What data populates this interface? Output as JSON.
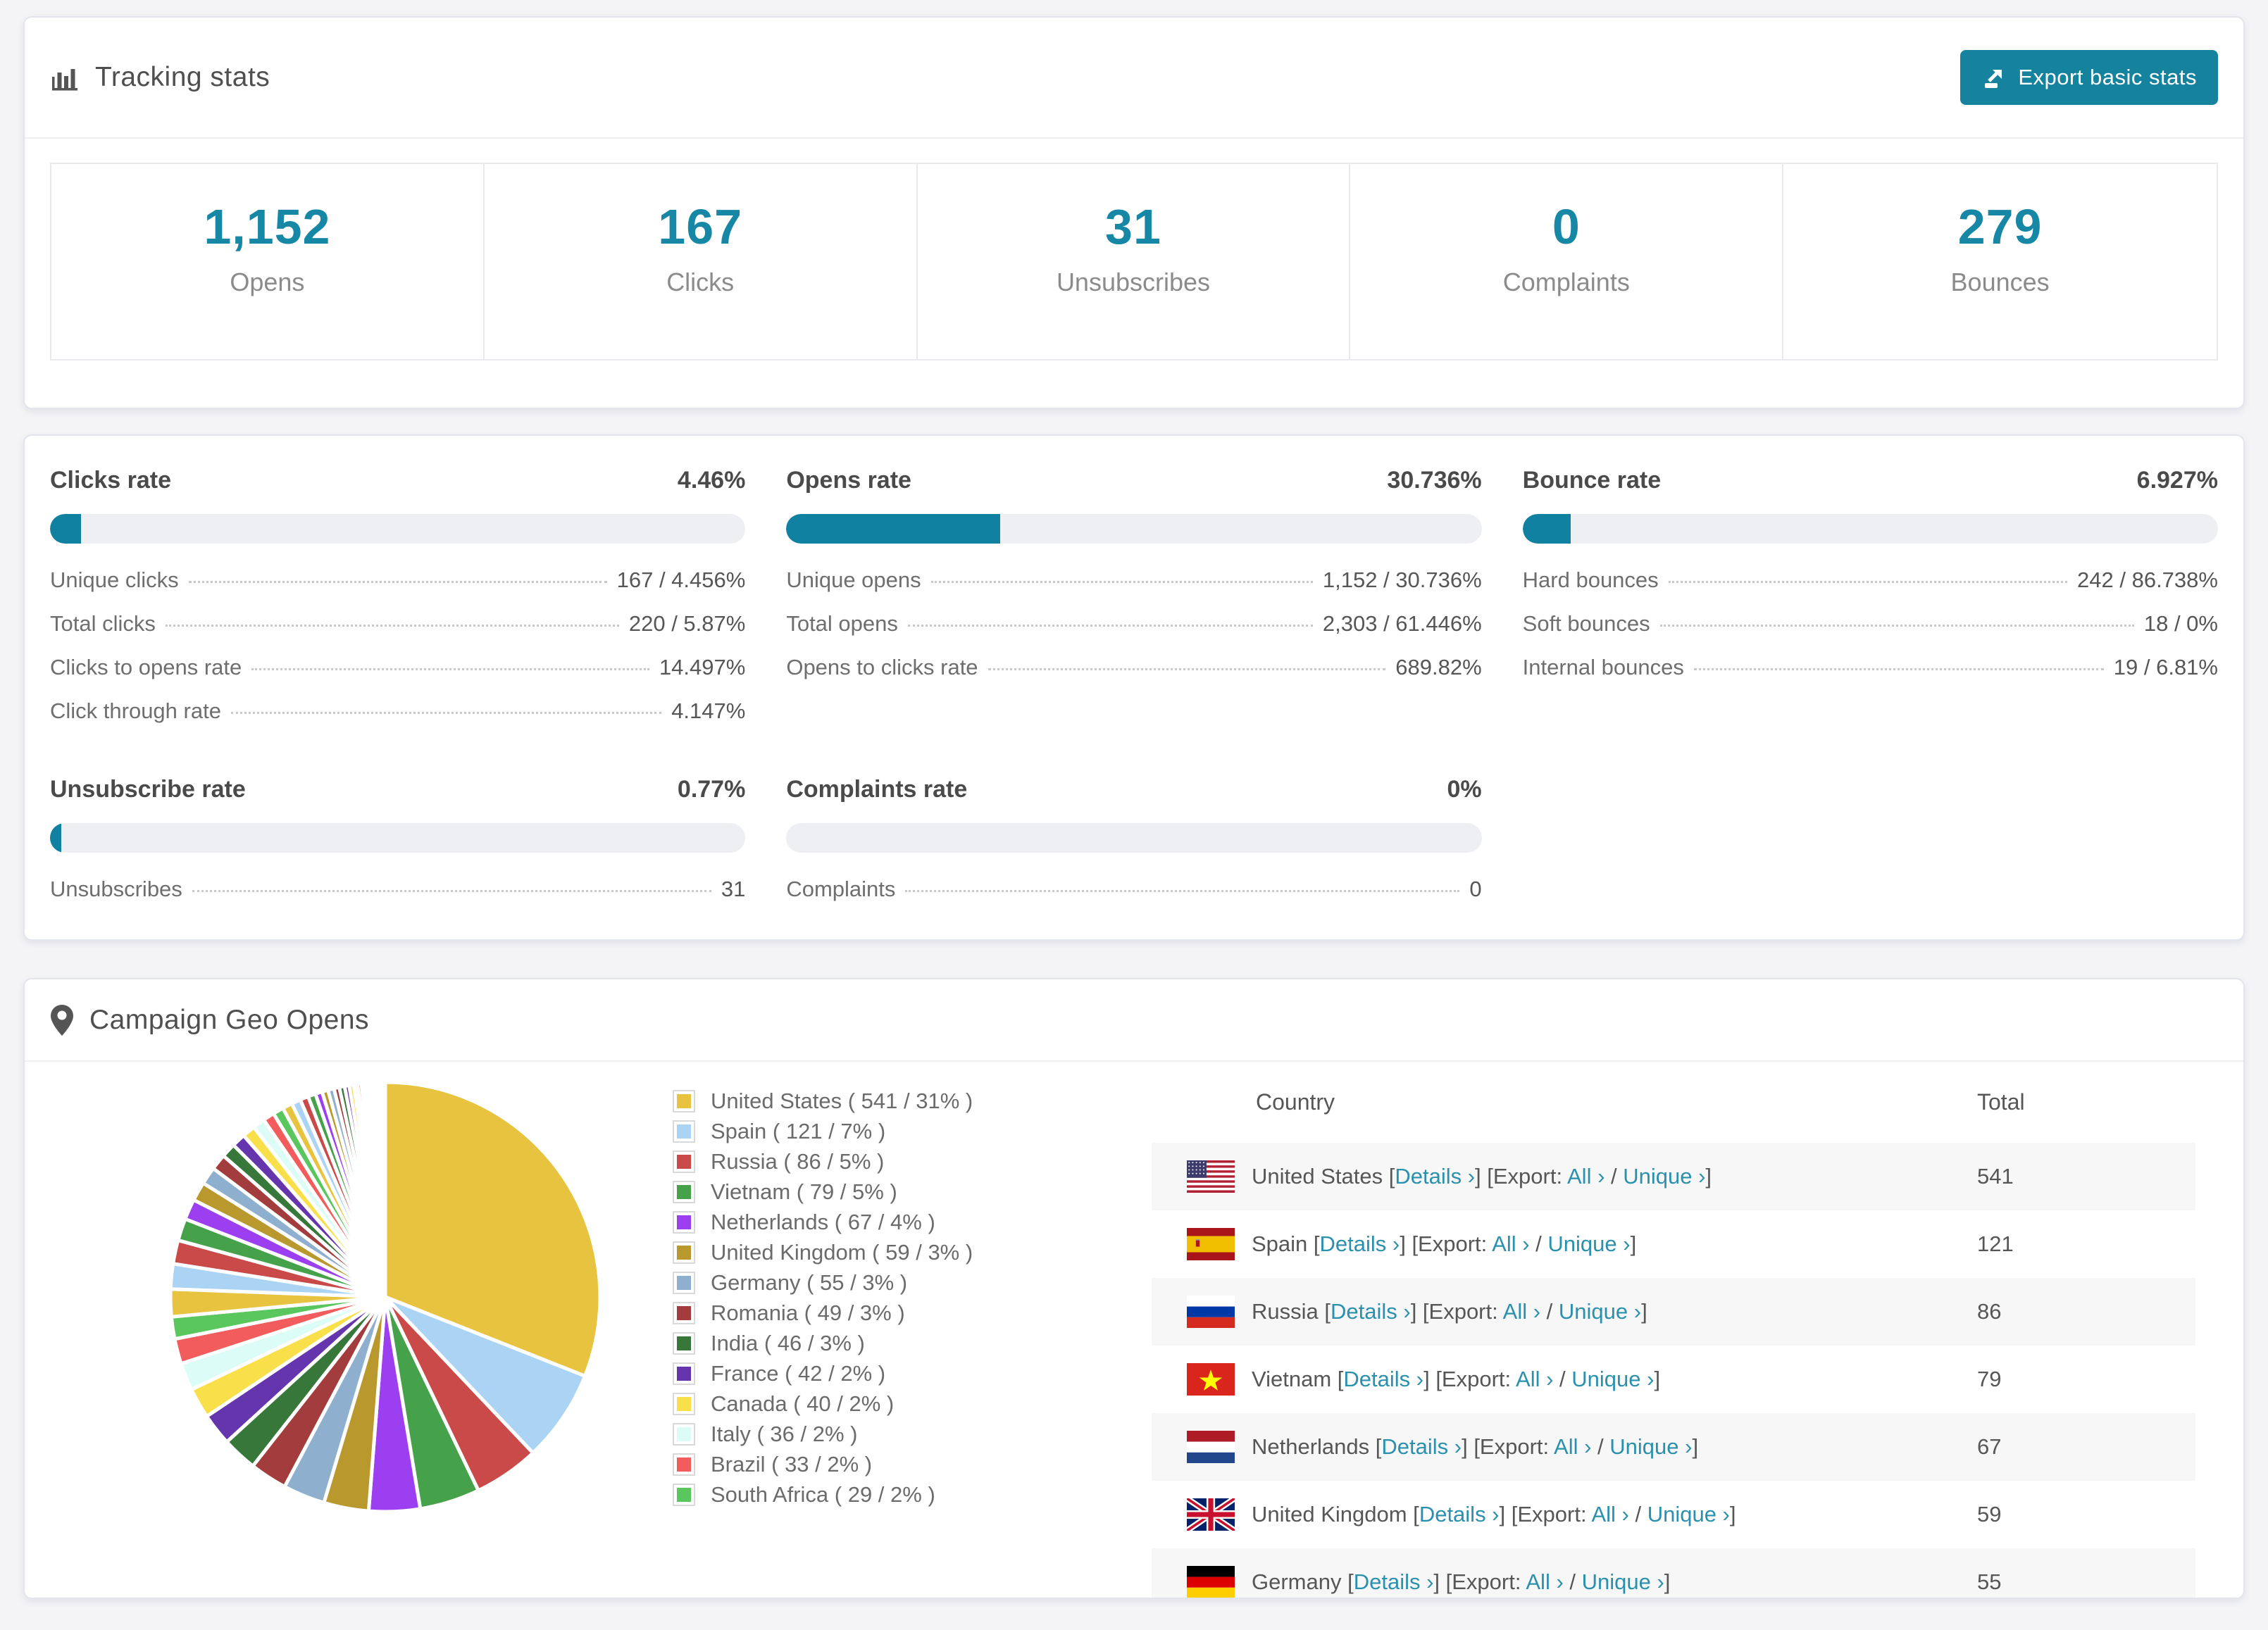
{
  "accent": {
    "teal_number": "#1787a6",
    "bar_fill": "#1081a1",
    "link": "#2b90ae",
    "button_bg": "#15839e"
  },
  "tracking": {
    "title": "Tracking stats",
    "export_button": "Export basic stats",
    "stats": [
      {
        "value": "1,152",
        "label": "Opens"
      },
      {
        "value": "167",
        "label": "Clicks"
      },
      {
        "value": "31",
        "label": "Unsubscribes"
      },
      {
        "value": "0",
        "label": "Complaints"
      },
      {
        "value": "279",
        "label": "Bounces"
      }
    ]
  },
  "rates": {
    "blocks": [
      {
        "title": "Clicks rate",
        "value": "4.46%",
        "percent": 4.46,
        "rows": [
          [
            "Unique clicks",
            "167 / 4.456%"
          ],
          [
            "Total clicks",
            "220 / 5.87%"
          ],
          [
            "Clicks to opens rate",
            "14.497%"
          ],
          [
            "Click through rate",
            "4.147%"
          ]
        ]
      },
      {
        "title": "Opens rate",
        "value": "30.736%",
        "percent": 30.736,
        "rows": [
          [
            "Unique opens",
            "1,152 / 30.736%"
          ],
          [
            "Total opens",
            "2,303 / 61.446%"
          ],
          [
            "Opens to clicks rate",
            "689.82%"
          ]
        ]
      },
      {
        "title": "Bounce rate",
        "value": "6.927%",
        "percent": 6.927,
        "rows": [
          [
            "Hard bounces",
            "242 / 86.738%"
          ],
          [
            "Soft bounces",
            "18 / 0%"
          ],
          [
            "Internal bounces",
            "19 / 6.81%"
          ]
        ]
      },
      {
        "title": "Unsubscribe rate",
        "value": "0.77%",
        "percent": 0.77,
        "rows": [
          [
            "Unsubscribes",
            "31"
          ]
        ]
      },
      {
        "title": "Complaints rate",
        "value": "0%",
        "percent": 0,
        "rows": [
          [
            "Complaints",
            "0"
          ]
        ]
      }
    ]
  },
  "geo": {
    "title": "Campaign Geo Opens",
    "table": {
      "col_country": "Country",
      "col_total": "Total",
      "bracket_open": "[",
      "bracket_close": "]",
      "details_label": "Details ›",
      "export_label": "Export:",
      "all_label": "All ›",
      "slash": "/",
      "unique_label": "Unique ›",
      "rows": [
        {
          "country": "United States",
          "flag": "us",
          "total": "541"
        },
        {
          "country": "Spain",
          "flag": "es",
          "total": "121"
        },
        {
          "country": "Russia",
          "flag": "ru",
          "total": "86"
        },
        {
          "country": "Vietnam",
          "flag": "vn",
          "total": "79"
        },
        {
          "country": "Netherlands",
          "flag": "nl",
          "total": "67"
        },
        {
          "country": "United Kingdom",
          "flag": "gb",
          "total": "59"
        },
        {
          "country": "Germany",
          "flag": "de",
          "total": "55"
        }
      ]
    }
  },
  "chart_data": {
    "type": "pie",
    "title": "Campaign Geo Opens",
    "legend_position": "right",
    "start_angle_deg": 0,
    "direction": "clockwise",
    "slices": [
      {
        "label": "United States",
        "legend": "United States ( 541 / 31% )",
        "value": 541,
        "pct": 31,
        "color": "#e8c33f"
      },
      {
        "label": "Spain",
        "legend": "Spain ( 121 / 7% )",
        "value": 121,
        "pct": 7,
        "color": "#abd4f4"
      },
      {
        "label": "Russia",
        "legend": "Russia ( 86 / 5% )",
        "value": 86,
        "pct": 5,
        "color": "#ca4a4a"
      },
      {
        "label": "Vietnam",
        "legend": "Vietnam ( 79 / 5% )",
        "value": 79,
        "pct": 5,
        "color": "#46a24a"
      },
      {
        "label": "Netherlands",
        "legend": "Netherlands ( 67 / 4% )",
        "value": 67,
        "pct": 4,
        "color": "#9b3ff0"
      },
      {
        "label": "United Kingdom",
        "legend": "United Kingdom ( 59 / 3% )",
        "value": 59,
        "pct": 3,
        "color": "#b9982e"
      },
      {
        "label": "Germany",
        "legend": "Germany ( 55 / 3% )",
        "value": 55,
        "pct": 3,
        "color": "#8eb0ce"
      },
      {
        "label": "Romania",
        "legend": "Romania ( 49 / 3% )",
        "value": 49,
        "pct": 3,
        "color": "#a33d3d"
      },
      {
        "label": "India",
        "legend": "India ( 46 / 3% )",
        "value": 46,
        "pct": 3,
        "color": "#37783a"
      },
      {
        "label": "France",
        "legend": "France ( 42 / 2% )",
        "value": 42,
        "pct": 2,
        "color": "#6535ae"
      },
      {
        "label": "Canada",
        "legend": "Canada ( 40 / 2% )",
        "value": 40,
        "pct": 2,
        "color": "#f9e04b"
      },
      {
        "label": "Italy",
        "legend": "Italy ( 36 / 2% )",
        "value": 36,
        "pct": 2,
        "color": "#dcfcf7"
      },
      {
        "label": "Brazil",
        "legend": "Brazil ( 33 / 2% )",
        "value": 33,
        "pct": 2,
        "color": "#f25c5c"
      },
      {
        "label": "South Africa",
        "legend": "South Africa ( 29 / 2% )",
        "value": 29,
        "pct": 2,
        "color": "#59c75e"
      }
    ],
    "other_small_slices_estimated_values": [
      36,
      33,
      31,
      29,
      27,
      25,
      23,
      21,
      19,
      18,
      17,
      16,
      15,
      14,
      13,
      12,
      11,
      10,
      9,
      8,
      8,
      7,
      7,
      6,
      6,
      5,
      5,
      4,
      4,
      3,
      3,
      3,
      2,
      2,
      2,
      2,
      1,
      1,
      1,
      1,
      1,
      1
    ],
    "palette_cycle": [
      "#e8c33f",
      "#abd4f4",
      "#ca4a4a",
      "#46a24a",
      "#9b3ff0",
      "#b9982e",
      "#8eb0ce",
      "#a33d3d",
      "#37783a",
      "#6535ae",
      "#f9e04b",
      "#dcfcf7",
      "#f25c5c",
      "#59c75e"
    ]
  }
}
